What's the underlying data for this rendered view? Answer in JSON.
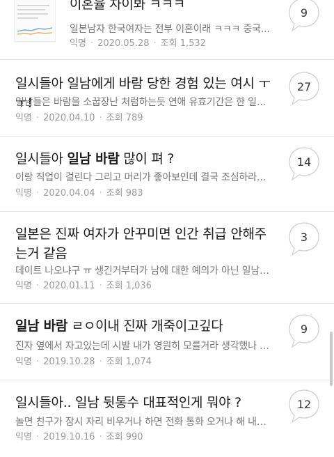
{
  "posts": [
    {
      "title": "이혼율 차이봐 ㅋㅋㅋ",
      "preview": "일본남자 한국여자는 전부 이혼이래 ㅋㅋㅋ 중국...",
      "author": "익명",
      "date": "2020.05.28",
      "views": "조회 1,532",
      "comments": "9"
    },
    {
      "title": "일시들아 일남에게 바람 당한 경험 있는 여시 ㅜㅜ!",
      "preview": "일남들은 바람을 소꿉장난 처럼하는듯 연애 유효기간은 한 일년...",
      "author": "익명",
      "date": "2020.04.10",
      "views": "조회 789",
      "comments": "27"
    },
    {
      "title_pre": "일시들아 ",
      "title_bold": "일남 바람",
      "title_post": " 많이 펴 ?",
      "preview": "이랑 직업이 걸린다 그리고 머리가 좋아보인데 결국 조심하라는...",
      "author": "익명",
      "date": "2020.04.04",
      "views": "조회 983",
      "comments": "14"
    },
    {
      "title": "일본은 진짜 여자가 안꾸미면 인간 취급 안해주는거 같음",
      "preview": "데이트 나오냐구 ㅠ 생긴거부터가 남에 대한 예의가 아닌 일남들...",
      "author": "익명",
      "date": "2020.01.11",
      "views": "조회 1,036",
      "comments": "3"
    },
    {
      "title_bold": "일남 바람",
      "title_post": " ㄹㅇ이내 진짜 개죽이고깊다",
      "preview": "진자 옆에서 자고있는데 시발 내가 영원히 모를거라 생각했나 찟...",
      "author": "익명",
      "date": "2019.10.28",
      "views": "조회 1,074",
      "comments": "9"
    },
    {
      "title": "일시들아.. 일남 뒷통수 대표적인게 뭐야 ?",
      "preview": "놀면 친구가 잠시 자리 비우거나 하면 전화 통화 오거나 해 내가...",
      "author": "익명",
      "date": "2019.10.16",
      "views": "조회 990",
      "comments": "12"
    }
  ],
  "icons": {
    "comment": "speech-bubble-icon"
  },
  "colors": {
    "title": "#1b1b1b",
    "meta": "#9a9a9a",
    "divider": "#e6e6e6"
  }
}
